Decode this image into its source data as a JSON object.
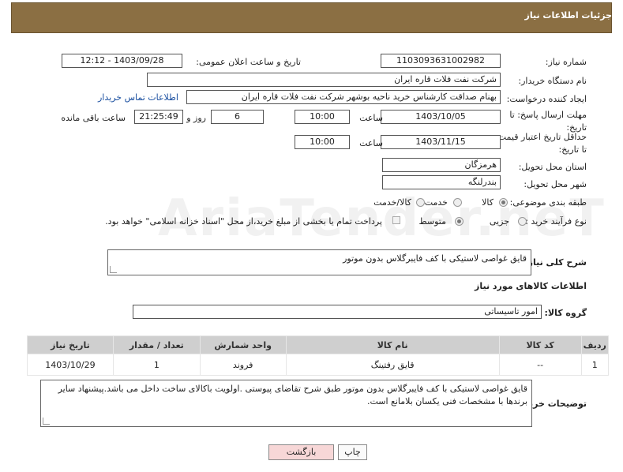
{
  "header": {
    "title": "جزئیات اطلاعات نیاز"
  },
  "form": {
    "need_number_label": "شماره نیاز:",
    "need_number": "1103093631002982",
    "announce_label": "تاریخ و ساعت اعلان عمومی:",
    "announce_value": "1403/09/28 - 12:12",
    "buyer_org_label": "نام دستگاه خریدار:",
    "buyer_org": "شرکت نفت فلات قاره ایران",
    "creator_label": "ایجاد کننده درخواست:",
    "creator": "بهنام  صداقت کارشناس خرید ناحیه بوشهر شرکت نفت فلات قاره ایران",
    "contact_link": "اطلاعات تماس خریدار",
    "reply_deadline_label": "مهلت ارسال پاسخ: تا تاریخ:",
    "reply_date": "1403/10/05",
    "time_label": "ساعت",
    "reply_time": "10:00",
    "days_value": "6",
    "days_label": "روز و",
    "remaining_time": "21:25:49",
    "remaining_label": "ساعت باقی مانده",
    "price_deadline_label": "حداقل تاریخ اعتبار قیمت: تا تاریخ:",
    "price_date": "1403/11/15",
    "price_time": "10:00",
    "province_label": "استان محل تحویل:",
    "province": "هرمزگان",
    "city_label": "شهر محل تحویل:",
    "city": "بندرلنگه",
    "category_label": "طبقه بندی موضوعی:",
    "category_options": [
      "کالا",
      "خدمت",
      "کالا/خدمت"
    ],
    "process_label": "نوع فرآیند خرید :",
    "process_options": [
      "جزیی",
      "متوسط"
    ],
    "payment_note": "پرداخت تمام یا بخشی از مبلغ خرید،از محل \"اسناد خزانه اسلامی\" خواهد بود.",
    "summary_label": "شرح کلی نیاز:",
    "summary": "قایق غواصی لاستیکی با کف فایبرگلاس بدون موتور"
  },
  "goods": {
    "section_title": "اطلاعات کالاهای مورد نیاز",
    "group_label": "گروه کالا:",
    "group_value": "امور تاسیساتی",
    "columns": [
      "ردیف",
      "کد کالا",
      "نام کالا",
      "واحد شمارش",
      "تعداد / مقدار",
      "تاریخ نیاز"
    ],
    "rows": [
      {
        "row": "1",
        "code": "--",
        "name": "قایق رفتینگ",
        "unit": "فروند",
        "qty": "1",
        "date": "1403/10/29"
      }
    ]
  },
  "buyer_notes": {
    "label": "توضیحات خریدار:",
    "text": "قایق غواصی لاستیکی با کف فایبرگلاس بدون موتور طبق شرح تقاضای پیوستی .اولویت باکالای ساخت داخل می باشد.پیشنهاد سایر برندها با مشخصات فنی یکسان بلامانع است."
  },
  "buttons": {
    "print": "چاپ",
    "back": "بازگشت"
  },
  "watermark": "AriaTender.neT",
  "colors": {
    "header_bg": "#8b6f43",
    "link": "#1a4fa0",
    "back_btn": "#f7d7d7"
  }
}
